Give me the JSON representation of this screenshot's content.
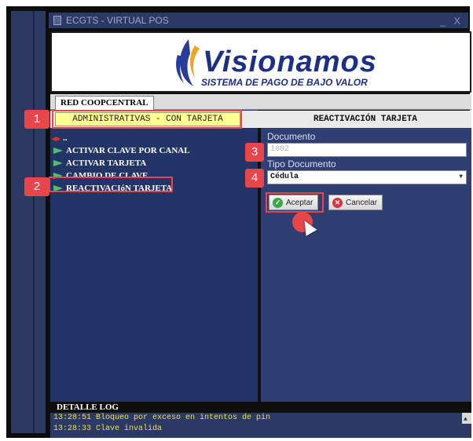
{
  "window": {
    "title": "ECGTS - VIRTUAL POS",
    "minimize": "_",
    "close": "X"
  },
  "logo": {
    "name": "Visionamos",
    "subtitle": "SISTEMA DE PAGO DE BAJO VALOR"
  },
  "tab": {
    "label": "RED COOPCENTRAL"
  },
  "left_header": "ADMINISTRATIVAS - CON TARJETA",
  "right_header": "REACTIVACIÓN TARJETA",
  "menu": {
    "back_label": "..",
    "items": [
      {
        "label": "ACTIVAR CLAVE POR CANAL"
      },
      {
        "label": "ACTIVAR TARJETA"
      },
      {
        "label": "CAMBIO DE CLAVE"
      },
      {
        "label": "REACTIVACIóN TARJETA"
      }
    ]
  },
  "form": {
    "documento_label": "Documento",
    "documento_value": "1002",
    "tipo_label": "Tipo Documento",
    "tipo_value": "Cédula"
  },
  "buttons": {
    "accept": "Aceptar",
    "cancel": "Cancelar"
  },
  "callouts": [
    "1",
    "2",
    "3",
    "4"
  ],
  "log": {
    "title": "DETALLE LOG",
    "lines": [
      "13:28:51 Bloqueo por exceso en intentos de pin",
      "13:28:33 Clave invalida"
    ]
  },
  "colors": {
    "accent": "#e8464a",
    "panel": "#223566",
    "highlight": "#fdfd92",
    "log_text": "#e9e046"
  }
}
